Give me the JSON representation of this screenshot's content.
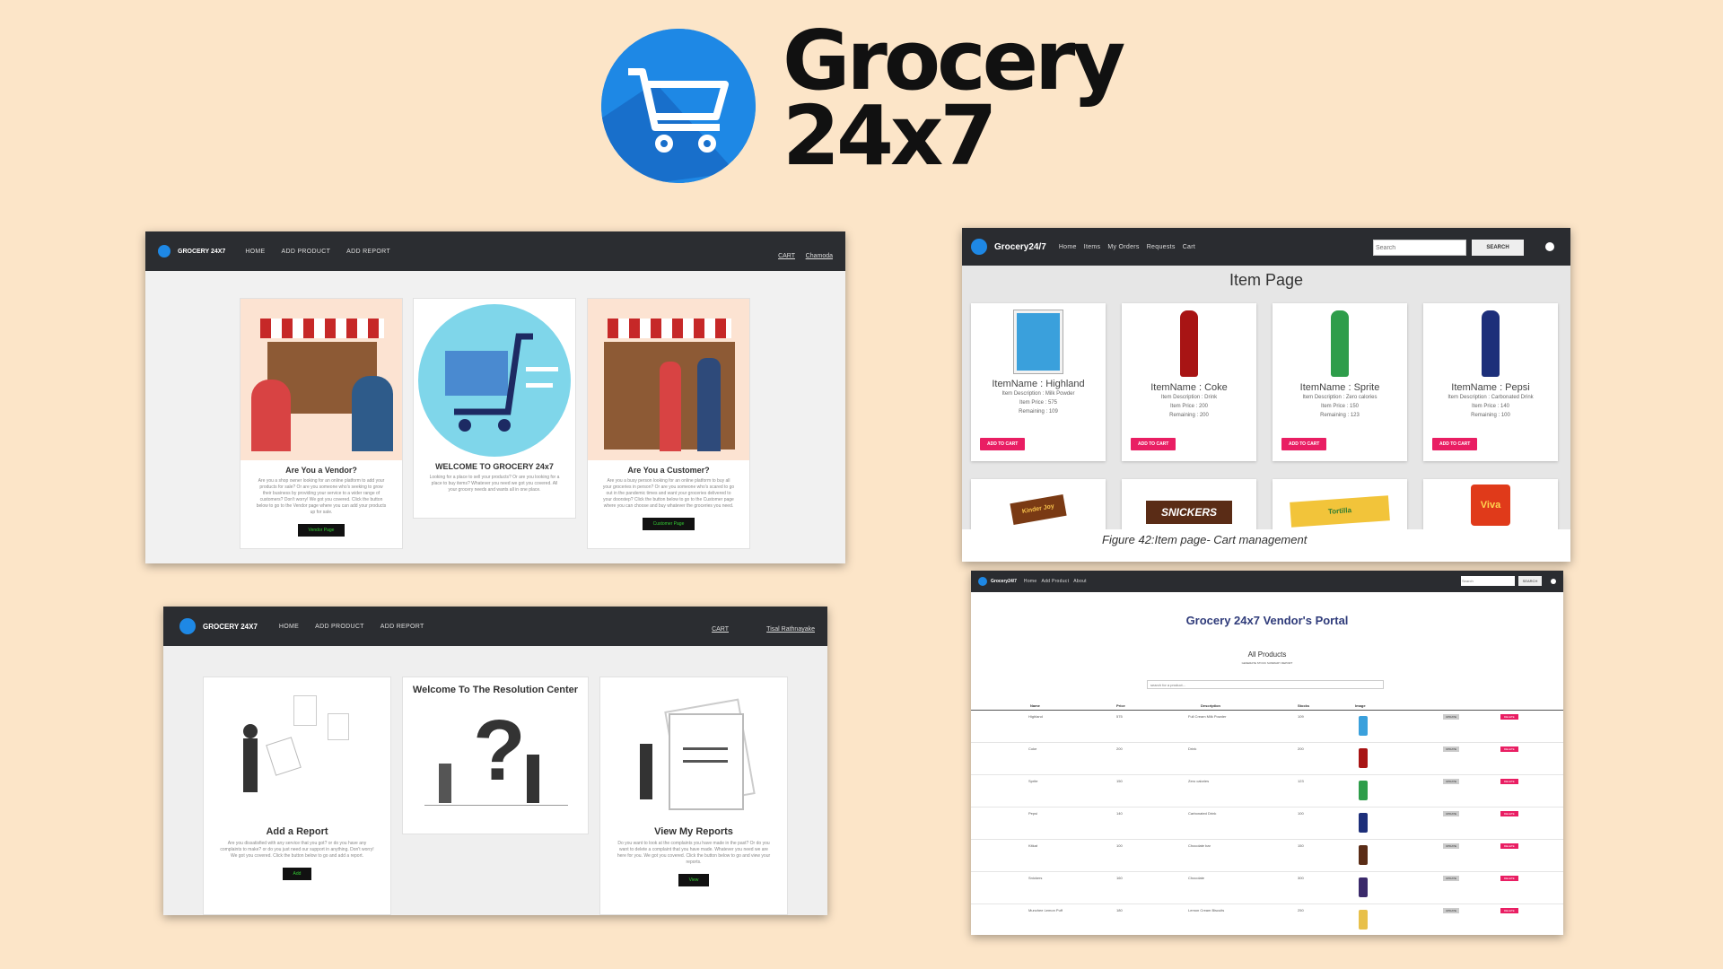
{
  "brand": {
    "line1": "Grocery",
    "line2": "24x7"
  },
  "colors": {
    "background": "#fce5c8",
    "brand_blue": "#1e7fd6",
    "nav_dark": "#2b2d31",
    "accent_pink": "#e91e63"
  },
  "screen1": {
    "nav": {
      "title": "GROCERY 24X7",
      "links": [
        "HOME",
        "ADD PRODUCT",
        "ADD REPORT"
      ],
      "cart": "CART",
      "user": "Chamoda"
    },
    "cards": [
      {
        "title": "Are You a Vendor?",
        "text": "Are you a shop owner looking for an online platform to add your products for sale? Or are you someone who's seeking to grow their business by providing your service to a wider range of customers? Don't worry! We got you covered. Click the button below to go to the Vendor page where you can add your products up for sale.",
        "button": "Vendor Page"
      },
      {
        "title": "WELCOME TO GROCERY 24x7",
        "text": "Looking for a place to sell your products? Or are you looking for a place to buy items? Whatever you need we got you covered. All your grocery needs and wants all in one place."
      },
      {
        "title": "Are You a Customer?",
        "text": "Are you a busy person looking for an online platform to buy all your groceries in person? Or are you someone who's scared to go out in the pandemic times and want your groceries delivered to your doorstep? Click the button below to go to the Customer page where you can choose and buy whatever the groceries you need.",
        "button": "Customer Page"
      }
    ]
  },
  "screen2": {
    "nav": {
      "title": "Grocery24/7",
      "links": [
        "Home",
        "Items",
        "My Orders",
        "Requests",
        "Cart"
      ],
      "search_placeholder": "Search",
      "search_button": "SEARCH"
    },
    "heading": "Item Page",
    "items": [
      {
        "name": "ItemName : Highland",
        "desc": "Item Description : Milk Powder",
        "price": "Item Price : 575",
        "remaining": "Remaining : 109"
      },
      {
        "name": "ItemName : Coke",
        "desc": "Item Description : Drink",
        "price": "Item Price : 200",
        "remaining": "Remaining : 200"
      },
      {
        "name": "ItemName : Sprite",
        "desc": "Item Description : Zero calories",
        "price": "Item Price : 150",
        "remaining": "Remaining : 123"
      },
      {
        "name": "ItemName : Pepsi",
        "desc": "Item Description : Carbonated Drink",
        "price": "Item Price : 140",
        "remaining": "Remaining : 100"
      }
    ],
    "add_to_cart": "ADD TO CART",
    "bottom_labels": [
      "Kinder Joy",
      "SNICKERS",
      "Tortilla",
      "Viva"
    ],
    "caption": "Figure 42:Item page- Cart management"
  },
  "screen3": {
    "nav": {
      "title": "GROCERY 24X7",
      "links": [
        "HOME",
        "ADD PRODUCT",
        "ADD REPORT"
      ],
      "cart": "CART",
      "user": "Tisal Rathnayake"
    },
    "cards": [
      {
        "title": "Add a Report",
        "text": "Are you dissatisfied with any service that you got? or do you have any complaints to make? or do you just need our support in anything. Don't worry! We got you covered. Click the button below to go and add a report.",
        "button": "Add"
      },
      {
        "title": "Welcome To The Resolution Center"
      },
      {
        "title": "View My Reports",
        "text": "Do you want to look at the complaints you have made in the past? Or do you want to delete a complaint that you have made. Whatever you need we are here for you. We got you covered. Click the button below to go and view your reports.",
        "button": "View"
      }
    ]
  },
  "screen4": {
    "nav": {
      "title": "Grocery24/7",
      "links": [
        "Home",
        "Add Product",
        "About"
      ],
      "search_placeholder": "Search",
      "search_button": "SEARCH"
    },
    "heading": "Grocery 24x7 Vendor's Portal",
    "sub": "All Products",
    "report_link": "GENERATE STOCK SUMMARY REPORT",
    "search_placeholder": "search for a product...",
    "columns": [
      "Name",
      "Price",
      "Description",
      "Stocks",
      "Image"
    ],
    "update": "UPDATE",
    "delete": "DELETE",
    "rows": [
      {
        "name": "Highland",
        "price": "575",
        "desc": "Full Cream Milk Powder",
        "stock": "109"
      },
      {
        "name": "Coke",
        "price": "200",
        "desc": "Drink",
        "stock": "200"
      },
      {
        "name": "Sprite",
        "price": "150",
        "desc": "Zero calories",
        "stock": "123"
      },
      {
        "name": "Pepsi",
        "price": "140",
        "desc": "Carbonated Drink",
        "stock": "100"
      },
      {
        "name": "Kitkat",
        "price": "100",
        "desc": "Chocolate bar",
        "stock": "150"
      },
      {
        "name": "Snickers",
        "price": "160",
        "desc": "Chocolate",
        "stock": "300"
      },
      {
        "name": "Munchee Lemon Puff",
        "price": "180",
        "desc": "Lemon Cream Biscuits",
        "stock": "250"
      }
    ]
  }
}
